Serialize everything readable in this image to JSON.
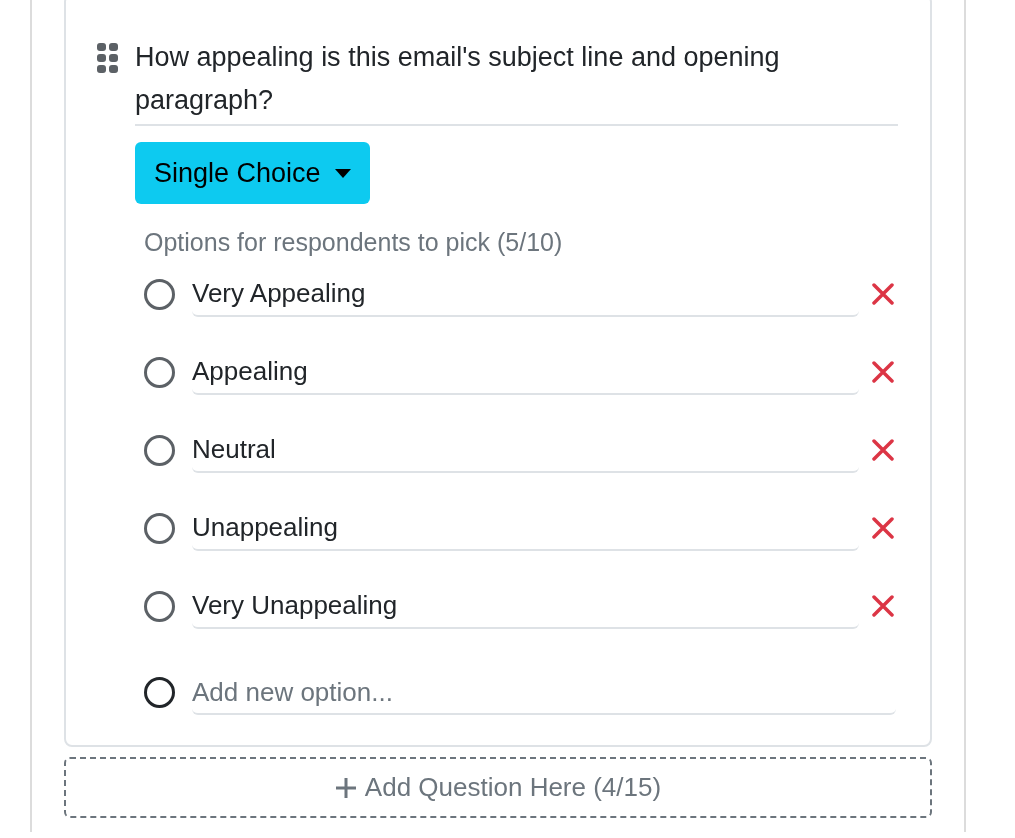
{
  "question": {
    "text": "How appealing is this email's subject line and opening paragraph?"
  },
  "type_button": {
    "label": "Single Choice"
  },
  "options_hint": "Options for respondents to pick (5/10)",
  "options": [
    {
      "label": "Very Appealing",
      "selected": false
    },
    {
      "label": "Appealing",
      "selected": false
    },
    {
      "label": "Neutral",
      "selected": false
    },
    {
      "label": "Unappealing",
      "selected": false
    },
    {
      "label": "Very Unappealing",
      "selected": false
    }
  ],
  "new_option": {
    "placeholder": "Add new option...",
    "selected": false
  },
  "add_question": {
    "label": "Add Question Here (4/15)"
  }
}
